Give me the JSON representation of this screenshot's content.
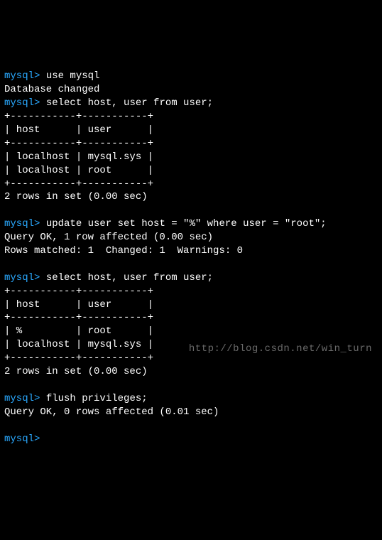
{
  "prompt": "mysql>",
  "cmd1": " use mysql",
  "out1": "Database changed",
  "cmd2": " select host, user from user;",
  "tbl1": {
    "sep": "+-----------+-----------+",
    "header": "| host      | user      |",
    "r1": "| localhost | mysql.sys |",
    "r2": "| localhost | root      |"
  },
  "out2": "2 rows in set (0.00 sec)",
  "cmd3": " update user set host = \"%\" where user = \"root\";",
  "out3a": "Query OK, 1 row affected (0.00 sec)",
  "out3b": "Rows matched: 1  Changed: 1  Warnings: 0",
  "cmd4": " select host, user from user;",
  "tbl2": {
    "sep": "+-----------+-----------+",
    "header": "| host      | user      |",
    "r1": "| %         | root      |",
    "r2": "| localhost | mysql.sys |"
  },
  "out4": "2 rows in set (0.00 sec)",
  "cmd5": " flush privileges;",
  "out5": "Query OK, 0 rows affected (0.01 sec)",
  "blank": "",
  "watermark": "http://blog.csdn.net/win_turn"
}
